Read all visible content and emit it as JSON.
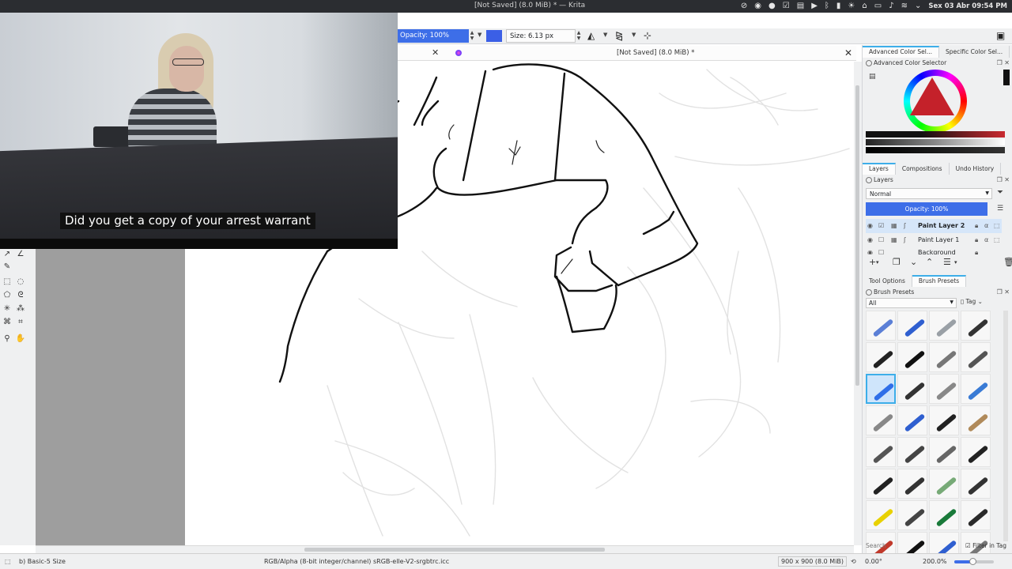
{
  "system_bar": {
    "window_title": "[Not Saved] (8.0 MiB) * — Krita",
    "clock": "Sex 03 Abr 09:54 PM",
    "tray_icons": [
      "network-off-icon",
      "discord-icon",
      "record-icon",
      "check-icon",
      "clipboard-icon",
      "play-icon",
      "bluetooth-icon",
      "battery-icon",
      "brightness-icon",
      "pin-icon",
      "display-icon",
      "volume-icon",
      "wifi-icon",
      "chevron-icon"
    ]
  },
  "toolbar": {
    "opacity_label": "Opacity: 100%",
    "size_label": "Size: 6.13 px",
    "brush_color": "#3b5fe6"
  },
  "document_tab": {
    "title": "[Not Saved]  (8.0 MiB) *"
  },
  "video_overlay": {
    "caption": "Did you get a copy of your arrest warrant"
  },
  "right_panel": {
    "color_tabs": [
      "Advanced Color Sel...",
      "Specific Color Sel..."
    ],
    "color_dock_title": "Advanced Color Selector",
    "layer_tabs": [
      "Layers",
      "Compositions",
      "Undo History"
    ],
    "layers_dock_title": "Layers",
    "blend_mode": "Normal",
    "layer_opacity": "Opacity: 100%",
    "layers": [
      {
        "name": "Paint Layer 2",
        "selected": true
      },
      {
        "name": "Paint Layer 1",
        "selected": false
      },
      {
        "name": "Background",
        "selected": false
      }
    ],
    "lower_tabs": [
      "Tool Options",
      "Brush Presets"
    ],
    "brush_dock_title": "Brush Presets",
    "brush_filter": "All",
    "tag_label": "Tag",
    "search_placeholder": "Search",
    "filter_in_tag": "Filter in Tag"
  },
  "status_bar": {
    "brush_name": "b) Basic-5 Size",
    "color_profile": "RGB/Alpha (8-bit integer/channel)  sRGB-elle-V2-srgbtrc.icc",
    "image_size": "900 x 900 (8.0 MiB)",
    "rotation": "0.00°",
    "zoom": "200.0%",
    "zoom_fraction": 0.45
  },
  "colors": {
    "accent": "#3daee9",
    "selection_blue": "#3d6ee8",
    "panel_bg": "#eff0f1"
  }
}
